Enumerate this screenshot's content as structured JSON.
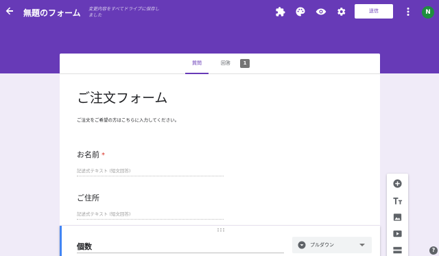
{
  "header": {
    "title": "無題のフォーム",
    "saved_note": "変更内容をすべてドライブに保存しました",
    "send_label": "送信",
    "avatar_initial": "N",
    "icons": [
      "arrow-back-icon",
      "puzzle-icon",
      "palette-icon",
      "eye-icon",
      "gear-icon",
      "more-vert-icon"
    ]
  },
  "tabs": {
    "questions_label": "質問",
    "responses_label": "回答",
    "response_count": "1"
  },
  "form": {
    "title": "ご注文フォーム",
    "description": "ご注文をご希望の方はこちらに入力してください。",
    "questions": [
      {
        "title": "お名前",
        "required": "*",
        "placeholder": "記述式テキスト (短文回答)"
      },
      {
        "title": "ご住所",
        "placeholder": "記述式テキスト (短文回答)"
      }
    ],
    "active_question": {
      "title": "個数",
      "type_label": "プルダウン"
    }
  },
  "side_toolbar": {
    "icons": [
      "add-question-icon",
      "title-text-icon",
      "image-icon",
      "video-icon",
      "section-icon"
    ]
  },
  "help_label": "?",
  "colors": {
    "brand": "#673ab7",
    "active_border": "#4285f4",
    "background": "#f0ebf8",
    "avatar": "#1e8e3e"
  }
}
